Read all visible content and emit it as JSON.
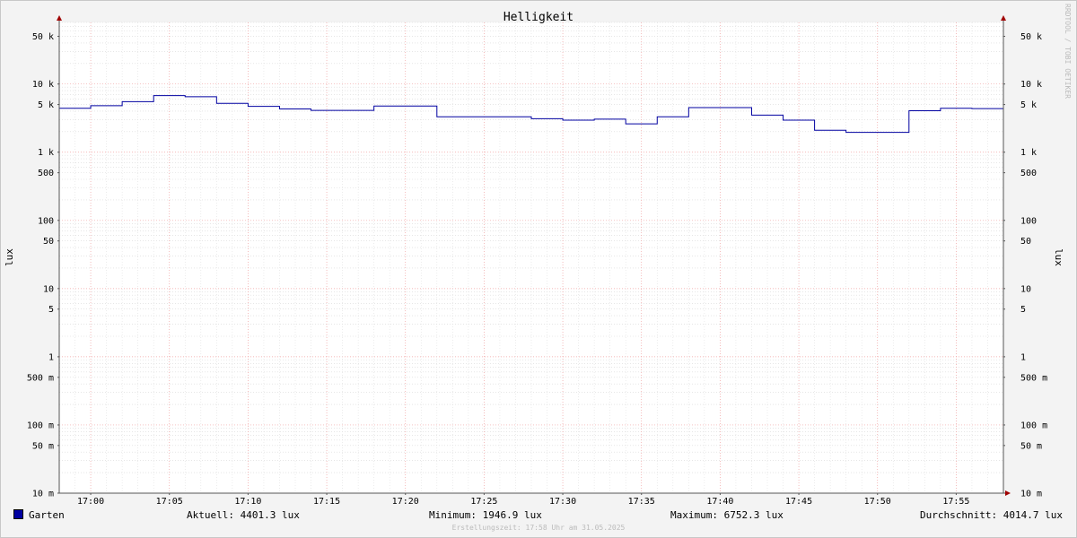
{
  "chart_data": {
    "type": "line",
    "title": "Helligkeit",
    "ylabel": "lux",
    "ylabel_right": "lux",
    "yscale": "log",
    "ylim": [
      0.01,
      80000
    ],
    "xlim": [
      "16:58",
      "17:58"
    ],
    "x_ticks": [
      "17:00",
      "17:05",
      "17:10",
      "17:15",
      "17:20",
      "17:25",
      "17:30",
      "17:35",
      "17:40",
      "17:45",
      "17:50",
      "17:55"
    ],
    "y_ticks": [
      {
        "value": 50000,
        "label": "50 k"
      },
      {
        "value": 10000,
        "label": "10 k"
      },
      {
        "value": 5000,
        "label": "5 k"
      },
      {
        "value": 1000,
        "label": "1 k"
      },
      {
        "value": 500,
        "label": "500"
      },
      {
        "value": 100,
        "label": "100"
      },
      {
        "value": 50,
        "label": "50"
      },
      {
        "value": 10,
        "label": "10"
      },
      {
        "value": 5,
        "label": "5"
      },
      {
        "value": 1,
        "label": "1"
      },
      {
        "value": 0.5,
        "label": "500 m"
      },
      {
        "value": 0.1,
        "label": "100 m"
      },
      {
        "value": 0.05,
        "label": "50 m"
      },
      {
        "value": 0.01,
        "label": "10 m"
      }
    ],
    "grid": true,
    "series": [
      {
        "name": "Garten",
        "color": "#0000a0",
        "step": true,
        "x": [
          "16:58",
          "17:00",
          "17:02",
          "17:04",
          "17:06",
          "17:08",
          "17:10",
          "17:12",
          "17:14",
          "17:18",
          "17:22",
          "17:28",
          "17:30",
          "17:32",
          "17:34",
          "17:36",
          "17:38",
          "17:42",
          "17:44",
          "17:46",
          "17:48",
          "17:52",
          "17:54",
          "17:56",
          "17:58"
        ],
        "values": [
          4400,
          4800,
          5500,
          6750,
          6500,
          5200,
          4700,
          4300,
          4100,
          4750,
          3300,
          3100,
          2950,
          3050,
          2600,
          3300,
          4500,
          3500,
          2950,
          2100,
          1950,
          4050,
          4400,
          4350,
          4350
        ]
      }
    ]
  },
  "watermark": "RRDTOOL / TOBI OETIKER",
  "legend": {
    "series_name": "Garten",
    "current": "Aktuell: 4401.3 lux",
    "minimum": "Minimum: 1946.9 lux",
    "maximum": "Maximum: 6752.3 lux",
    "average": "Durchschnitt: 4014.7 lux"
  },
  "footer": "Erstellungszeit: 17:58 Uhr am 31.05.2025"
}
